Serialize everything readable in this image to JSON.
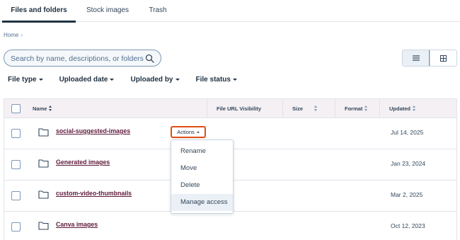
{
  "tabs": [
    {
      "label": "Files and folders",
      "active": true
    },
    {
      "label": "Stock images",
      "active": false
    },
    {
      "label": "Trash",
      "active": false
    }
  ],
  "breadcrumb": {
    "home": "Home",
    "separator": "›"
  },
  "search": {
    "placeholder": "Search by name, descriptions, or folders",
    "value": "",
    "icon": "search-icon"
  },
  "view_toggle": {
    "options": [
      "list-view-icon",
      "grid-view-icon"
    ],
    "selected": "list-view-icon"
  },
  "filters": [
    {
      "label": "File type"
    },
    {
      "label": "Uploaded date"
    },
    {
      "label": "Uploaded by"
    },
    {
      "label": "File status"
    }
  ],
  "table": {
    "columns": {
      "name": "Name",
      "url_visibility": "File URL Visibility",
      "size": "Size",
      "format": "Format",
      "updated": "Updated"
    },
    "rows": [
      {
        "name": "social-suggested-images",
        "updated": "Jul 14, 2025"
      },
      {
        "name": "Generated images",
        "updated": "Jan 23, 2024"
      },
      {
        "name": "custom-video-thumbnails",
        "updated": "Mar 2, 2025"
      },
      {
        "name": "Canva images",
        "updated": "Oct 12, 2023"
      }
    ]
  },
  "actions": {
    "label": "Actions",
    "highlight_color": "#e04d16",
    "menu": [
      "Rename",
      "Move",
      "Delete",
      "Manage access"
    ],
    "hovered": "Manage access"
  },
  "colors": {
    "link": "#5e1a3a",
    "header_bg": "#f5f0f4",
    "text": "#33475b"
  }
}
